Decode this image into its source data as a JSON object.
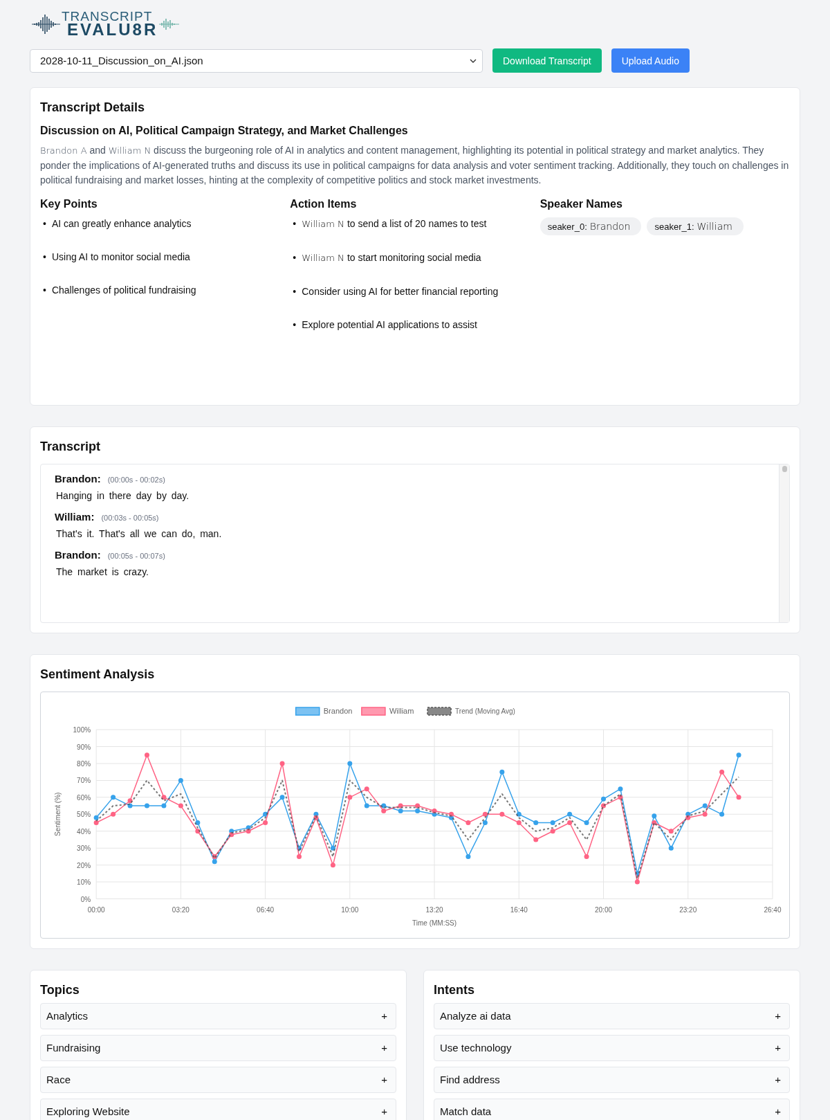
{
  "logo": {
    "line_1": "TRANSCRIPT",
    "line_2": "EVALU8R"
  },
  "file_select": {
    "value": "2028-10-11_Discussion_on_AI.json"
  },
  "buttons": [
    {
      "label": "Download Transcript",
      "kind": "download"
    },
    {
      "label": "Upload Audio",
      "kind": "upload"
    }
  ],
  "details": {
    "heading": "Transcript Details",
    "title": "Discussion on AI, Political Campaign Strategy, and Market Challenges",
    "summary": [
      {
        "text": "Brandon A",
        "kind": "name"
      },
      {
        "text": " and ",
        "kind": "plain"
      },
      {
        "text": "William N",
        "kind": "name"
      },
      {
        "text": " discuss the burgeoning role of AI in analytics and content management, highlighting its potential in political strategy and market analytics. They ponder the implications of AI-generated truths and discuss its use in political campaigns for data analysis and voter sentiment tracking. Additionally, they touch on challenges in political fundraising and market losses, hinting at the complexity of competitive politics and stock market investments.",
        "kind": "plain"
      }
    ],
    "key_points": {
      "heading": "Key Points",
      "items": [
        {
          "bullet": "•",
          "text": "AI can greatly enhance analytics"
        },
        {
          "bullet": "•",
          "text": "Using AI to monitor social media"
        },
        {
          "bullet": "•",
          "text": "Challenges of political fundraising"
        }
      ]
    },
    "action_items": {
      "heading": "Action Items",
      "items": [
        {
          "bullet": "•",
          "segments": [
            {
              "text": "William N ",
              "kind": "name"
            },
            {
              "text": " to send a list of 20 names to test",
              "kind": "plain"
            }
          ]
        },
        {
          "bullet": "•",
          "segments": [
            {
              "text": "William N ",
              "kind": "name"
            },
            {
              "text": " to start monitoring social media",
              "kind": "plain"
            }
          ]
        },
        {
          "bullet": "•",
          "segments": [
            {
              "text": "Consider using AI for better financial reporting",
              "kind": "plain"
            }
          ]
        },
        {
          "bullet": "•",
          "segments": [
            {
              "text": "Explore potential AI applications to assist",
              "kind": "plain"
            }
          ]
        }
      ]
    },
    "speaker_names": {
      "heading": "Speaker Names",
      "items": [
        {
          "id": "seaker_0:",
          "name": "Brandon"
        },
        {
          "id": "seaker_1:",
          "name": "William"
        }
      ]
    }
  },
  "transcript": {
    "heading": "Transcript",
    "entries": [
      {
        "speaker": "Brandon:",
        "time": "(00:00s - 00:02s)",
        "text": "Hanging in there day by day."
      },
      {
        "speaker": "William:",
        "time": "(00:03s - 00:05s)",
        "text": "That's it. That's all we can do, man."
      },
      {
        "speaker": "Brandon:",
        "time": "(00:05s - 00:07s)",
        "text": "The market is crazy."
      }
    ]
  },
  "sentiment": {
    "heading": "Sentiment Analysis",
    "chart_data": {
      "type": "line",
      "grid": true,
      "legend": true,
      "xlabel": "Time (MM:SS)",
      "ylabel": "Sentiment (%)",
      "x": [
        0,
        40,
        80,
        120,
        160,
        200,
        240,
        280,
        320,
        360,
        400,
        440,
        480,
        520,
        560,
        600,
        640,
        680,
        720,
        760,
        800,
        840,
        880,
        920,
        960,
        1000,
        1040,
        1080,
        1120,
        1160,
        1200,
        1240,
        1280,
        1320,
        1360,
        1400,
        1440,
        1480,
        1520
      ],
      "series": [
        {
          "name": "Brandon",
          "color": "#36a2eb",
          "marker": "circle",
          "line_style": "solid",
          "values": [
            48,
            60,
            55,
            55,
            55,
            70,
            45,
            22,
            40,
            42,
            50,
            60,
            30,
            50,
            30,
            80,
            55,
            55,
            52,
            52,
            50,
            48,
            25,
            45,
            75,
            50,
            45,
            45,
            50,
            45,
            59,
            65,
            15,
            49,
            30,
            50,
            55,
            50,
            85
          ]
        },
        {
          "name": "William",
          "color": "#ff6384",
          "marker": "circle",
          "line_style": "solid",
          "values": [
            45,
            50,
            58,
            85,
            60,
            55,
            40,
            25,
            38,
            40,
            45,
            80,
            25,
            48,
            20,
            60,
            65,
            52,
            55,
            55,
            52,
            50,
            45,
            50,
            50,
            45,
            35,
            40,
            45,
            25,
            55,
            60,
            10,
            45,
            40,
            48,
            50,
            75,
            60
          ]
        },
        {
          "name": "Trend (Moving Avg)",
          "color": "#555555",
          "marker": "none",
          "line_style": "dashed",
          "values": [
            46,
            55,
            56,
            70,
            58,
            62,
            42,
            24,
            39,
            41,
            48,
            70,
            28,
            49,
            25,
            70,
            60,
            54,
            54,
            54,
            51,
            49,
            35,
            48,
            62,
            48,
            40,
            42,
            48,
            35,
            55,
            62,
            12,
            45,
            35,
            49,
            52,
            62,
            72
          ]
        }
      ],
      "xlim": [
        0,
        1600
      ],
      "ylim": [
        0,
        100
      ],
      "xticks": [
        {
          "value": 0,
          "label": "00:00"
        },
        {
          "value": 200,
          "label": "03:20"
        },
        {
          "value": 400,
          "label": "06:40"
        },
        {
          "value": 600,
          "label": "10:00"
        },
        {
          "value": 800,
          "label": "13:20"
        },
        {
          "value": 1000,
          "label": "16:40"
        },
        {
          "value": 1200,
          "label": "20:00"
        },
        {
          "value": 1400,
          "label": "23:20"
        },
        {
          "value": 1600,
          "label": "26:40"
        }
      ],
      "yticks": [
        {
          "value": 0,
          "label": "0%"
        },
        {
          "value": 10,
          "label": "10%"
        },
        {
          "value": 20,
          "label": "20%"
        },
        {
          "value": 30,
          "label": "30%"
        },
        {
          "value": 40,
          "label": "40%"
        },
        {
          "value": 50,
          "label": "50%"
        },
        {
          "value": 60,
          "label": "60%"
        },
        {
          "value": 70,
          "label": "70%"
        },
        {
          "value": 80,
          "label": "80%"
        },
        {
          "value": 90,
          "label": "90%"
        },
        {
          "value": 100,
          "label": "100%"
        }
      ]
    }
  },
  "topics": {
    "heading": "Topics",
    "items": [
      {
        "label": "Analytics",
        "toggle": "+"
      },
      {
        "label": "Fundraising",
        "toggle": "+"
      },
      {
        "label": "Race",
        "toggle": "+"
      },
      {
        "label": "Exploring Website",
        "toggle": "+"
      }
    ]
  },
  "intents": {
    "heading": "Intents",
    "items": [
      {
        "label": "Analyze ai data",
        "toggle": "+"
      },
      {
        "label": "Use technology",
        "toggle": "+"
      },
      {
        "label": "Find address",
        "toggle": "+"
      },
      {
        "label": "Match data",
        "toggle": "+"
      }
    ]
  }
}
